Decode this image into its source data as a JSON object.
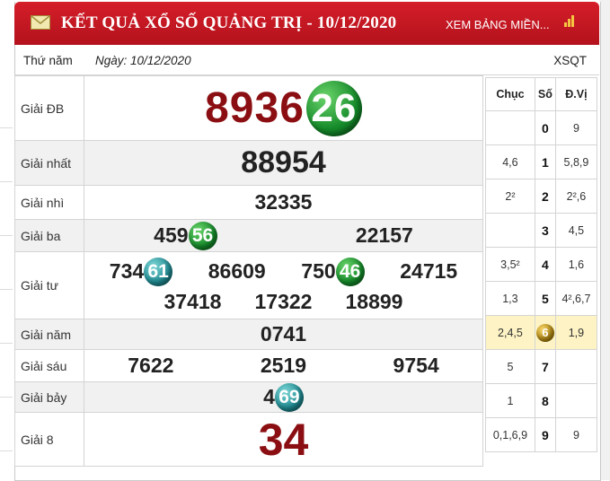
{
  "header": {
    "title": "KẾT QUẢ XỔ SỐ QUẢNG TRỊ - 10/12/2020",
    "link": "XEM BẢNG MIỀN...",
    "color": "#c8161f"
  },
  "info": {
    "weekday": "Thứ năm",
    "date": "Ngày: 10/12/2020",
    "code": "XSQT"
  },
  "prizes": {
    "db": {
      "label": "Giải ĐB",
      "prefix": "8936",
      "ball": "26"
    },
    "nhat": {
      "label": "Giải nhất",
      "values": [
        "88954"
      ]
    },
    "nhi": {
      "label": "Giải nhì",
      "values": [
        "32335"
      ]
    },
    "ba": {
      "label": "Giải ba",
      "v1_prefix": "459",
      "v1_ball": "56",
      "v2": "22157"
    },
    "tu": {
      "label": "Giải tư",
      "r1": [
        {
          "prefix": "734",
          "ball": "61"
        },
        {
          "prefix": "86609",
          "ball": ""
        },
        {
          "prefix": "750",
          "ball": "46"
        },
        {
          "prefix": "24715",
          "ball": ""
        }
      ],
      "r2": [
        "37418",
        "17322",
        "18899"
      ]
    },
    "nam": {
      "label": "Giải năm",
      "values": [
        "0741"
      ]
    },
    "sau": {
      "label": "Giải sáu",
      "values": [
        "7622",
        "2519",
        "9754"
      ]
    },
    "bay": {
      "label": "Giải bảy",
      "prefix": "4",
      "ball": "69"
    },
    "tam": {
      "label": "Giải 8",
      "values": [
        "34"
      ]
    }
  },
  "loto": {
    "headers": [
      "Chục",
      "Số",
      "Đ.Vị"
    ],
    "rows": [
      {
        "chuc": "",
        "so": "0",
        "dv": "9"
      },
      {
        "chuc": "4,6",
        "so": "1",
        "dv": "5,8,9"
      },
      {
        "chuc": "2²",
        "so": "2",
        "dv": "2²,6"
      },
      {
        "chuc": "",
        "so": "3",
        "dv": "4,5"
      },
      {
        "chuc": "3,5²",
        "so": "4",
        "dv": "1,6"
      },
      {
        "chuc": "1,3",
        "so": "5",
        "dv": "4²,6,7"
      },
      {
        "chuc": "2,4,5",
        "so": "6",
        "dv": "1,9"
      },
      {
        "chuc": "5",
        "so": "7",
        "dv": ""
      },
      {
        "chuc": "1",
        "so": "8",
        "dv": ""
      },
      {
        "chuc": "0,1,6,9",
        "so": "9",
        "dv": "9"
      }
    ]
  },
  "icons": [
    "mail-icon",
    "flag-icon"
  ]
}
